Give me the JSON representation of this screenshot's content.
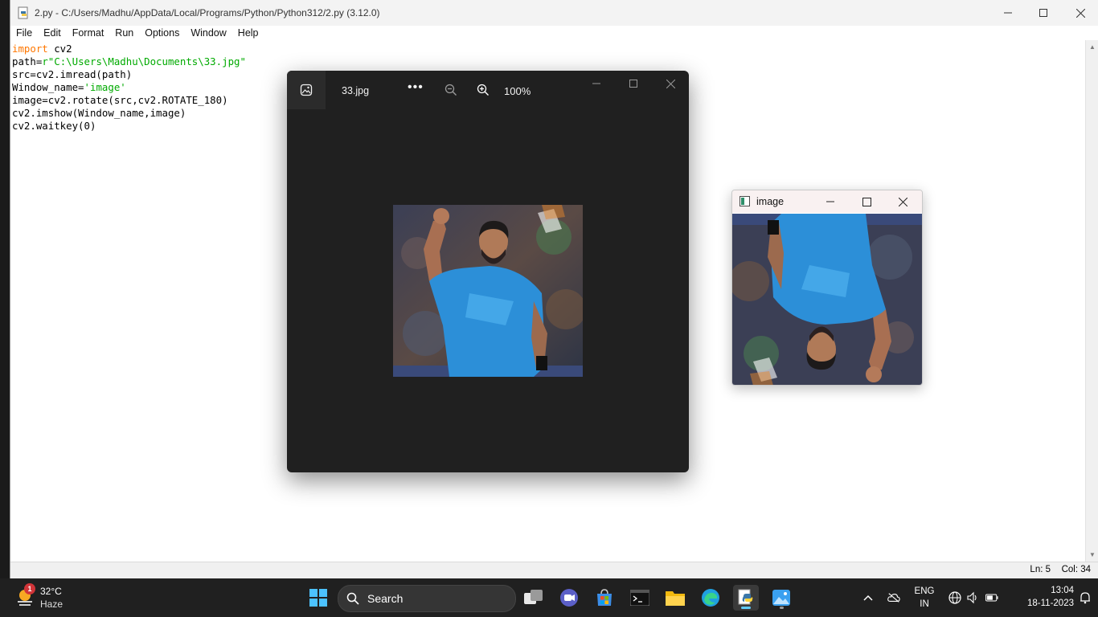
{
  "idle": {
    "title": "2.py - C:/Users/Madhu/AppData/Local/Programs/Python/Python312/2.py (3.12.0)",
    "menu": [
      "File",
      "Edit",
      "Format",
      "Run",
      "Options",
      "Window",
      "Help"
    ],
    "code": {
      "l1_kw": "import",
      "l1_rest": " cv2",
      "l2_a": "path=",
      "l2_str": "r\"C:\\Users\\Madhu\\Documents\\33.jpg\"",
      "l3": "src=cv2.imread(path)",
      "l4_a": "Window_name=",
      "l4_str": "'image'",
      "l5": "image=cv2.rotate(src,cv2.ROTATE_180)",
      "l6": "cv2.imshow(Window_name,image)",
      "l7": "cv2.waitkey(0)"
    },
    "status": {
      "ln": "Ln: 5",
      "col": "Col: 34"
    }
  },
  "photos": {
    "filename": "33.jpg",
    "more": "•••",
    "zoom": "100%"
  },
  "cv_window": {
    "title": "image"
  },
  "taskbar": {
    "weather": {
      "badge": "1",
      "temp": "32°C",
      "condition": "Haze"
    },
    "search_label": "Search",
    "lang_top": "ENG",
    "lang_bottom": "IN",
    "time": "13:04",
    "date": "18-11-2023"
  },
  "colors": {
    "taskbar_bg": "#202020",
    "photos_bg": "#202020",
    "keyword": "#ff7700",
    "string": "#00aa00",
    "accent": "#60cdff"
  }
}
